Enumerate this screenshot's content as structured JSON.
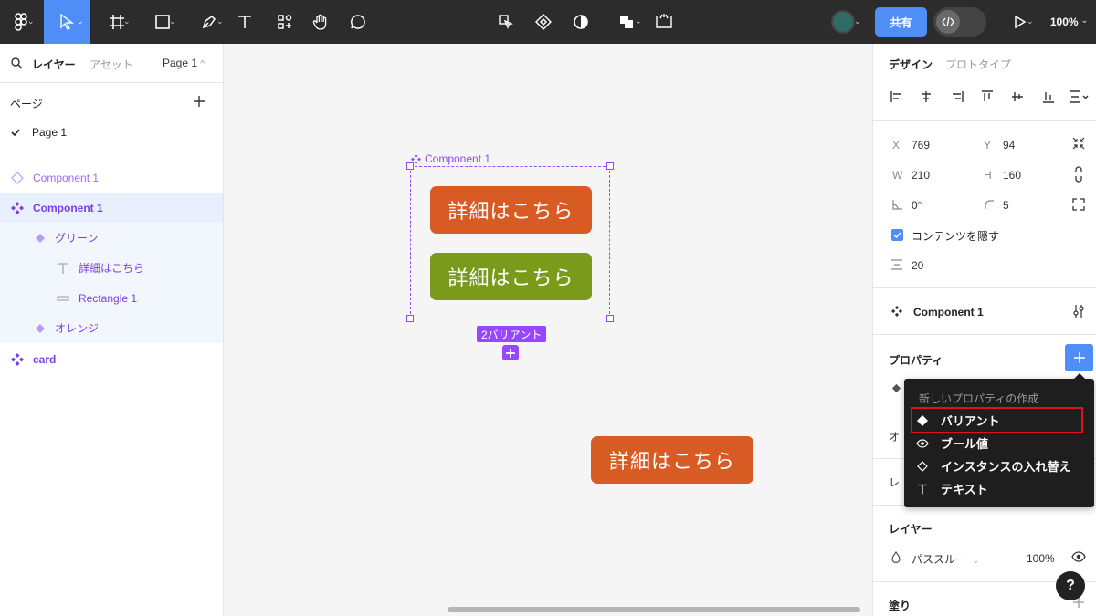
{
  "toolbar": {
    "share_label": "共有",
    "zoom_label": "100%",
    "avatar_color": "#2e6b66",
    "share_color": "#4f8ef7",
    "move_tool_color": "#4f8ef7"
  },
  "left_panel": {
    "tabs": {
      "layers": "レイヤー",
      "assets": "アセット"
    },
    "page_selector": "Page 1",
    "pages_header": "ページ",
    "pages": [
      "Page 1"
    ],
    "layers": [
      {
        "label": "Component 1",
        "icon": "component-outline-icon"
      },
      {
        "label": "Component 1",
        "icon": "component-set-icon"
      },
      {
        "label": "グリーン",
        "icon": "variant-diamond-icon"
      },
      {
        "label": "詳細はこちら",
        "icon": "text-icon"
      },
      {
        "label": "Rectangle 1",
        "icon": "rectangle-icon"
      },
      {
        "label": "オレンジ",
        "icon": "variant-diamond-icon"
      },
      {
        "label": "card",
        "icon": "component-set-icon"
      }
    ]
  },
  "canvas": {
    "frame_label": "Component 1",
    "variants_badge": "2バリアント",
    "button_text": "詳細はこちら",
    "orange": "#d95b24",
    "green": "#7a9a1c",
    "accent": "#9747ff"
  },
  "right_panel": {
    "tabs": {
      "design": "デザイン",
      "prototype": "プロトタイプ"
    },
    "x_label": "X",
    "x_value": "769",
    "y_label": "Y",
    "y_value": "94",
    "w_label": "W",
    "w_value": "210",
    "h_label": "H",
    "h_value": "160",
    "rotation_value": "0°",
    "radius_value": "5",
    "clip_content_label": "コンテンツを隠す",
    "gap_value": "20",
    "component_name": "Component 1",
    "properties_header": "プロパティ",
    "layer_header": "レイヤー",
    "blend_mode": "パススルー",
    "opacity": "100%",
    "fill_header": "塗り",
    "truncated_1": "オ",
    "truncated_2": "レ"
  },
  "menu": {
    "header": "新しいプロパティの作成",
    "items": [
      "バリアント",
      "ブール値",
      "インスタンスの入れ替え",
      "テキスト"
    ]
  },
  "help_label": "?"
}
